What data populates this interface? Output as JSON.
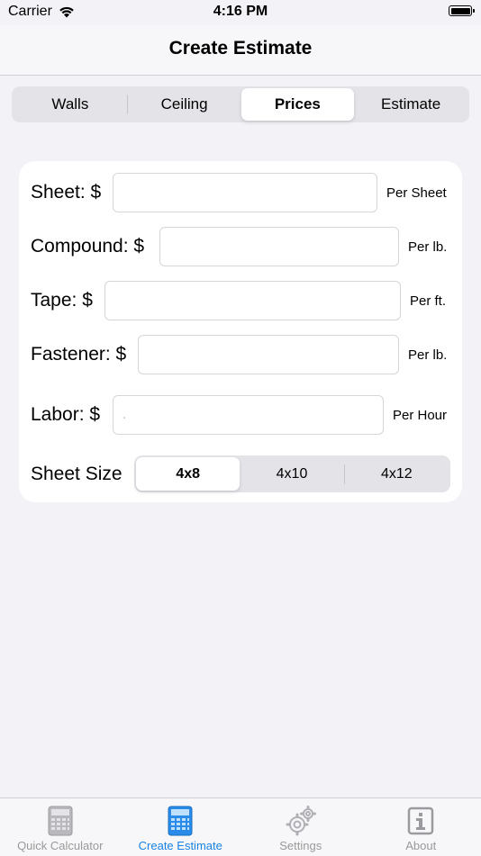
{
  "status_bar": {
    "carrier": "Carrier",
    "time": "4:16 PM"
  },
  "nav": {
    "title": "Create Estimate"
  },
  "top_tabs": [
    {
      "label": "Walls",
      "selected": false
    },
    {
      "label": "Ceiling",
      "selected": false
    },
    {
      "label": "Prices",
      "selected": true
    },
    {
      "label": "Estimate",
      "selected": false
    }
  ],
  "form": {
    "sheet": {
      "label": "Sheet: $",
      "value": "",
      "unit": "Per Sheet"
    },
    "compound": {
      "label": "Compound: $",
      "value": "",
      "unit": "Per lb."
    },
    "tape": {
      "label": "Tape: $",
      "value": "",
      "unit": "Per ft."
    },
    "fastener": {
      "label": "Fastener: $",
      "value": "",
      "unit": "Per lb."
    },
    "labor": {
      "label": "Labor: $",
      "value": "",
      "placeholder": ".",
      "unit": "Per Hour"
    },
    "sheet_size": {
      "label": "Sheet Size",
      "options": [
        "4x8",
        "4x10",
        "4x12"
      ],
      "selected": "4x8"
    }
  },
  "tab_bar": [
    {
      "label": "Quick Calculator",
      "icon": "calculator-icon",
      "active": false
    },
    {
      "label": "Create Estimate",
      "icon": "calculator-icon",
      "active": true
    },
    {
      "label": "Settings",
      "icon": "gear-icon",
      "active": false
    },
    {
      "label": "About",
      "icon": "info-icon",
      "active": false
    }
  ],
  "colors": {
    "accent": "#1a82e2",
    "background": "#f2f2f7",
    "inactive": "#999999"
  }
}
